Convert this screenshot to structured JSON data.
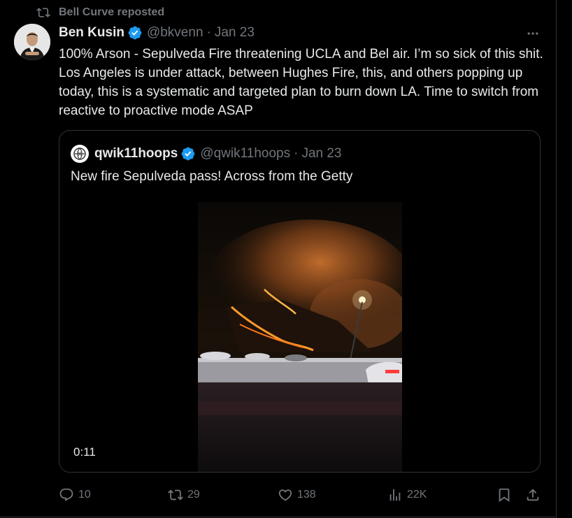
{
  "repost": {
    "label": "Bell Curve reposted",
    "icon": "repost-icon"
  },
  "tweet": {
    "author_name": "Ben Kusin",
    "handle": "@bkvenn",
    "separator": "·",
    "date": "Jan 23",
    "text": "100% Arson - Sepulveda Fire threatening UCLA and Bel air. I’m so sick of this shit. Los Angeles is under attack, between Hughes Fire, this, and others popping up today, this is a systematic and targeted plan to burn down LA. Time to switch from reactive to proactive mode ASAP"
  },
  "quote": {
    "author_name": "qwik11hoops",
    "handle": "@qwik11hoops",
    "separator": "·",
    "date": "Jan 23",
    "text": "New fire Sepulveda pass! Across from the Getty",
    "video_time": "0:11"
  },
  "actions": {
    "replies": "10",
    "reposts": "29",
    "likes": "138",
    "views": "22K"
  },
  "colors": {
    "background": "#000000",
    "text": "#e7e9ea",
    "muted": "#71767b",
    "verified": "#1d9bf0",
    "border": "#2f3336"
  }
}
